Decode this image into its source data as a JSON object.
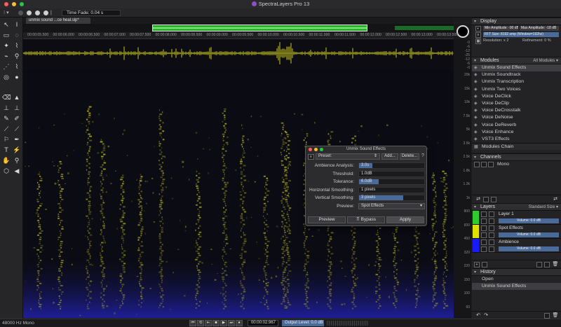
{
  "app": {
    "title": "SpectraLayers Pro 13"
  },
  "toolbar": {
    "time_fade": "Time Fade: 0.04 s"
  },
  "document": {
    "tab_label": "unmix sound ...ce heal.slp*"
  },
  "ruler": {
    "ticks": [
      "00:00:05.500",
      "00:00:06.000",
      "00:00:06.500",
      "00:00:07.000",
      "00:00:07.500",
      "00:00:08.000",
      "00:00:08.500",
      "00:00:09.000",
      "00:00:09.500",
      "00:00:10.000",
      "00:00:10.500",
      "00:00:11.000",
      "00:00:11.500",
      "00:00:12.000",
      "00:00:12.500",
      "00:00:13.000",
      "00:00:13.500"
    ]
  },
  "frequency_scale": {
    "labels": [
      "20k",
      "15k",
      "10k",
      "7.5k",
      "5k",
      "3.5k",
      "2.5k",
      "1.8k",
      "1.3k",
      "1k",
      "800",
      "600",
      "450",
      "320",
      "220",
      "150",
      "100",
      "60"
    ],
    "wave_labels": [
      "-0",
      "-6",
      "-12",
      "-25",
      "-12",
      "-6",
      "-0"
    ]
  },
  "display": {
    "title": "Display",
    "min_amplitude": "Min Amplitude: -90 dB",
    "max_amplitude": "Max Amplitude: -18 dB",
    "fft": "FFT Size: 8192 smp (Window=192hz)",
    "resolution": "Resolution: x 2",
    "refinement": "Refinement: 0 %"
  },
  "modules": {
    "title": "Modules",
    "filter": "All Modules",
    "items": [
      "Unmix Sound Effects",
      "Unmix Soundtrack",
      "Unmix Transcription",
      "Unmix Two Voices",
      "Voice DeClick",
      "Voice DeClip",
      "Voice DeCrosstalk",
      "Voice DeNoise",
      "Voice DeReverb",
      "Voice Enhance",
      "VST3 Effects"
    ],
    "chain_label": "Modules Chain"
  },
  "channels": {
    "title": "Channels",
    "items": [
      "Mono"
    ]
  },
  "layers": {
    "title": "Layers",
    "size": "Standard Size",
    "items": [
      {
        "name": "Layer 1",
        "volume": "Volume: 0.0 dB",
        "color": "#2ecc2e"
      },
      {
        "name": "Spot Effects",
        "volume": "Volume: 0.0 dB",
        "color": "#e0e000"
      },
      {
        "name": "Ambience",
        "volume": "Volume: 0.0 dB",
        "color": "#1a1aff"
      }
    ]
  },
  "history": {
    "title": "History",
    "items": [
      "Open",
      "Unmix Sound Effects"
    ]
  },
  "dialog": {
    "title": "Unmix Sound Effects",
    "preset_label": "Preset:",
    "add_label": "Add...",
    "delete_label": "Delete...",
    "params": [
      {
        "label": "Ambience Analysis:",
        "value": "3.0s",
        "fill": 0.2
      },
      {
        "label": "Threshold:",
        "value": "1.0dB",
        "fill": 0
      },
      {
        "label": "Tolerance:",
        "value": "6.0dB",
        "fill": 0.3
      },
      {
        "label": "Horizontal Smoothing:",
        "value": "1 pixels",
        "fill": 0
      },
      {
        "label": "Vertical Smoothing:",
        "value": "3 pixels",
        "fill": 0.68
      }
    ],
    "preview_label": "Preview:",
    "preview_value": "Spot Effects",
    "preview_button": "Preview",
    "bypass_button": "Bypass",
    "apply_button": "Apply"
  },
  "status": {
    "format": "48000 Hz Mono",
    "time": "00:00:02.967",
    "output_level": "Output Level: 0.0 dB"
  },
  "colors": {
    "spectrum": "#c8c820",
    "low_band": "#1f1f9a",
    "accent": "#4a6a9a"
  }
}
